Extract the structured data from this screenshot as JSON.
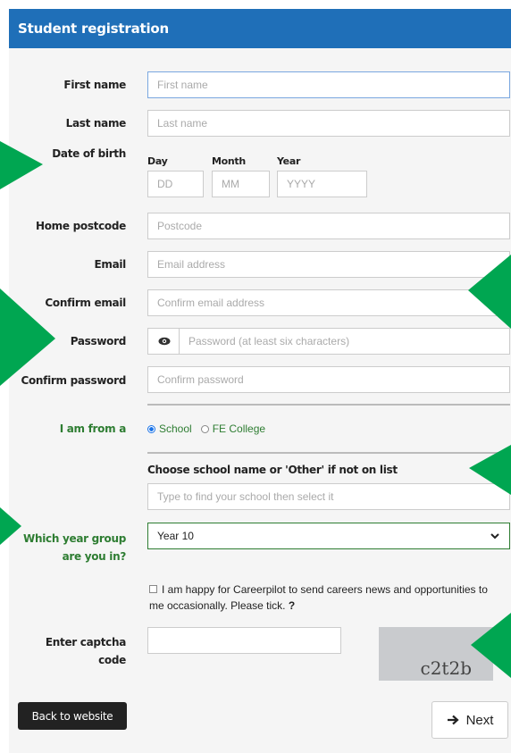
{
  "header": {
    "title": "Student registration"
  },
  "fields": {
    "first_name": {
      "label": "First name",
      "placeholder": "First name"
    },
    "last_name": {
      "label": "Last name",
      "placeholder": "Last name"
    },
    "dob": {
      "label": "Date of birth",
      "day_label": "Day",
      "day_placeholder": "DD",
      "month_label": "Month",
      "month_placeholder": "MM",
      "year_label": "Year",
      "year_placeholder": "YYYY"
    },
    "postcode": {
      "label": "Home postcode",
      "placeholder": "Postcode"
    },
    "email": {
      "label": "Email",
      "placeholder": "Email address"
    },
    "confirm_email": {
      "label": "Confirm email",
      "placeholder": "Confirm email address"
    },
    "password": {
      "label": "Password",
      "placeholder": "Password (at least six characters)",
      "toggle_icon": "eye-icon"
    },
    "confirm_password": {
      "label": "Confirm password",
      "placeholder": "Confirm password"
    }
  },
  "from": {
    "label": "I am from a",
    "options": [
      "School",
      "FE College"
    ],
    "selected": "School"
  },
  "school": {
    "label": "Choose school name or 'Other' if not on list",
    "placeholder": "Type to find your school then select it"
  },
  "year_group": {
    "label_line1": "Which year group",
    "label_line2": "are you in?",
    "value": "Year 10"
  },
  "consent": {
    "text": "I am happy for Careerpilot to send careers news and opportunities to me occasionally. Please tick.",
    "help": "?"
  },
  "captcha": {
    "label_line1": "Enter captcha",
    "label_line2": "code",
    "image_text": "c2t2b"
  },
  "buttons": {
    "back": "Back to website",
    "next": "Next"
  },
  "colors": {
    "header_bg": "#1f6fb8",
    "accent_green": "#00a651",
    "label_green": "#2e7d32"
  }
}
